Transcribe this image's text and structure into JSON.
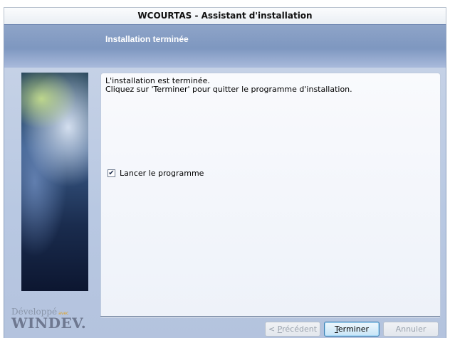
{
  "window": {
    "title": "WCOURTAS - Assistant d'installation"
  },
  "header": {
    "step_title": "Installation terminée"
  },
  "side_image": {
    "caption": ""
  },
  "brand": {
    "developed": "Développé",
    "with": "avec",
    "product": "WINDEV."
  },
  "content": {
    "line1": "L'installation est terminée.",
    "line2": "Cliquez sur 'Terminer' pour quitter le programme d'installation.",
    "launch_checkbox": {
      "label": "Lancer le programme",
      "checked": true
    }
  },
  "buttons": {
    "previous": {
      "prefix": "< ",
      "accel": "P",
      "rest": "récédent",
      "enabled": false
    },
    "finish": {
      "accel": "T",
      "rest": "erminer",
      "enabled": true
    },
    "cancel": {
      "label": "Annuler",
      "enabled": false
    }
  },
  "colors": {
    "header_band": "#7e97c0",
    "panel_bg": "#f6f8fc",
    "default_button": "#3c7fb1"
  }
}
